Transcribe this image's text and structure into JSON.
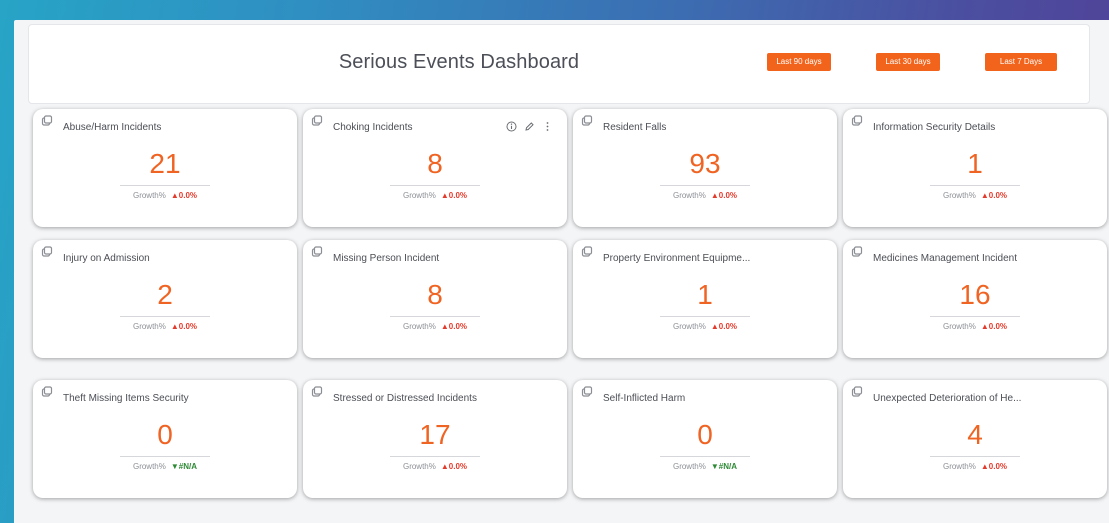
{
  "dashboard": {
    "title": "Serious Events Dashboard",
    "buttons": {
      "last_90": "Last 90 days",
      "last_30": "Last 30 days",
      "last_7": "Last 7 Days"
    },
    "growth_label": "Growth%",
    "colors": {
      "accent": "#f2641c",
      "value": "#f06423",
      "up": "#e33a2b",
      "down": "#2e8a35"
    },
    "cards": [
      {
        "title": "Abuse/Harm Incidents",
        "value": "21",
        "growth": "▲0.0%",
        "trend": "up"
      },
      {
        "title": "Choking Incidents",
        "value": "8",
        "growth": "▲0.0%",
        "trend": "up"
      },
      {
        "title": "Resident Falls",
        "value": "93",
        "growth": "▲0.0%",
        "trend": "up"
      },
      {
        "title": "Information Security Details",
        "value": "1",
        "growth": "▲0.0%",
        "trend": "up"
      },
      {
        "title": "Injury on Admission",
        "value": "2",
        "growth": "▲0.0%",
        "trend": "up"
      },
      {
        "title": "Missing Person Incident",
        "value": "8",
        "growth": "▲0.0%",
        "trend": "up"
      },
      {
        "title": "Property Environment Equipme...",
        "value": "1",
        "growth": "▲0.0%",
        "trend": "up"
      },
      {
        "title": "Medicines Management Incident",
        "value": "16",
        "growth": "▲0.0%",
        "trend": "up"
      },
      {
        "title": "Theft Missing Items Security",
        "value": "0",
        "growth": "▼#N/A",
        "trend": "down"
      },
      {
        "title": "Stressed or Distressed Incidents",
        "value": "17",
        "growth": "▲0.0%",
        "trend": "up"
      },
      {
        "title": "Self-Inflicted Harm",
        "value": "0",
        "growth": "▼#N/A",
        "trend": "down"
      },
      {
        "title": "Unexpected Deterioration of He...",
        "value": "4",
        "growth": "▲0.0%",
        "trend": "up"
      }
    ],
    "card_tools": [
      "info-icon",
      "edit-icon",
      "more-vertical-icon"
    ]
  }
}
